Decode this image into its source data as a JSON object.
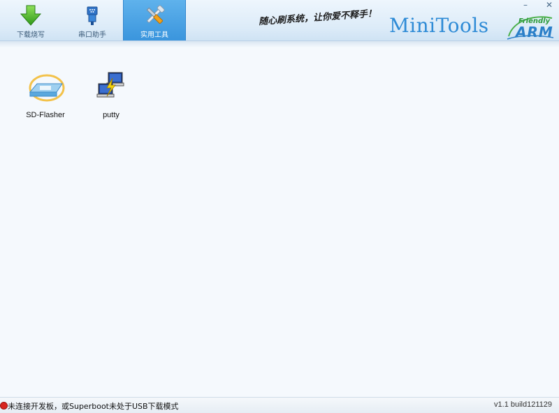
{
  "header": {
    "tabs": [
      {
        "label": "下载烧写",
        "icon": "download-arrow-icon",
        "active": false
      },
      {
        "label": "串口助手",
        "icon": "serial-port-icon",
        "active": false
      },
      {
        "label": "实用工具",
        "icon": "tools-icon",
        "active": true
      }
    ],
    "slogan": "随心刷系统，让你爱不释手！",
    "brand": "MiniTools",
    "logo": {
      "small": "Friendly",
      "big": "ARM"
    },
    "window_controls": {
      "minimize": "–",
      "close": "✕"
    }
  },
  "tools": [
    {
      "label": "SD-Flasher",
      "icon": "sd-card-icon"
    },
    {
      "label": "putty",
      "icon": "putty-computers-icon"
    }
  ],
  "status": {
    "message": "未连接开发板，或Superboot未处于USB下载模式",
    "version": "v1.1 build121129",
    "indicator_color": "#d8251f"
  },
  "colors": {
    "accent": "#3a95dd",
    "brand": "#2e8bd6"
  }
}
